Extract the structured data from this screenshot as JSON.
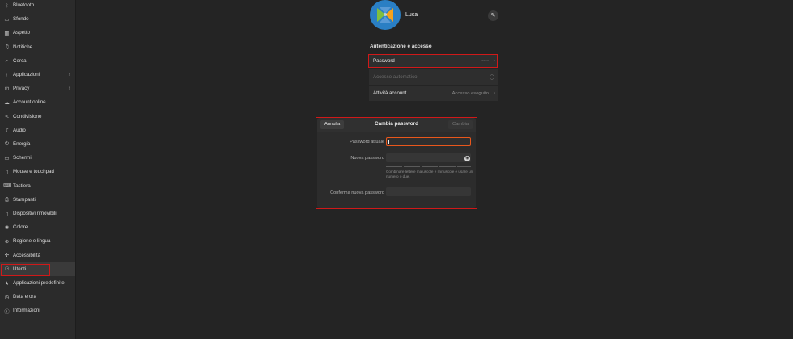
{
  "sidebar": {
    "items": [
      {
        "label": "Bluetooth",
        "icon": "bluetooth-icon",
        "glyph": "ᛒ"
      },
      {
        "label": "Sfondo",
        "icon": "wallpaper-icon",
        "glyph": "▭"
      },
      {
        "label": "Aspetto",
        "icon": "appearance-icon",
        "glyph": "▦"
      },
      {
        "label": "Notifiche",
        "icon": "bell-icon",
        "glyph": "♫"
      },
      {
        "label": "Cerca",
        "icon": "search-icon",
        "glyph": "⌕"
      },
      {
        "label": "Applicazioni",
        "icon": "apps-icon",
        "glyph": "⋮",
        "arrow": "›"
      },
      {
        "label": "Privacy",
        "icon": "lock-icon",
        "glyph": "⊡",
        "arrow": "›"
      },
      {
        "label": "Account online",
        "icon": "cloud-icon",
        "glyph": "☁"
      },
      {
        "label": "Condivisione",
        "icon": "share-icon",
        "glyph": "<"
      },
      {
        "label": "Audio",
        "icon": "music-note-icon",
        "glyph": "♪"
      },
      {
        "label": "Energia",
        "icon": "power-icon",
        "glyph": "⏻"
      },
      {
        "label": "Schermi",
        "icon": "display-icon",
        "glyph": "▭"
      },
      {
        "label": "Mouse e touchpad",
        "icon": "mouse-icon",
        "glyph": "▯"
      },
      {
        "label": "Tastiera",
        "icon": "keyboard-icon",
        "glyph": "⌨"
      },
      {
        "label": "Stampanti",
        "icon": "printer-icon",
        "glyph": "⎙"
      },
      {
        "label": "Dispositivi rimovibili",
        "icon": "usb-icon",
        "glyph": "▯"
      },
      {
        "label": "Colore",
        "icon": "palette-icon",
        "glyph": "✺"
      },
      {
        "label": "Regione e lingua",
        "icon": "globe-icon",
        "glyph": "⊕"
      },
      {
        "label": "Accessibilità",
        "icon": "accessibility-icon",
        "glyph": "✢"
      },
      {
        "label": "Utenti",
        "icon": "users-icon",
        "glyph": "⚇",
        "active": true
      },
      {
        "label": "Applicazioni predefinite",
        "icon": "star-icon",
        "glyph": "★"
      },
      {
        "label": "Data e ora",
        "icon": "clock-icon",
        "glyph": "◷"
      },
      {
        "label": "Informazioni",
        "icon": "info-icon",
        "glyph": "ⓘ"
      }
    ]
  },
  "user": {
    "name": "Luca",
    "edit_icon": "pencil-icon",
    "edit_glyph": "✎"
  },
  "auth": {
    "title": "Autenticazione e accesso",
    "password_label": "Password",
    "password_value": "•••••",
    "autologin_label": "Accesso automatico",
    "activity_label": "Attività account",
    "activity_value": "Accesso eseguito",
    "chevron": "›"
  },
  "dialog": {
    "title": "Cambia password",
    "cancel": "Annulla",
    "apply": "Cambia",
    "current_label": "Password attuale",
    "new_label": "Nuova password",
    "confirm_label": "Conferma nuova password",
    "hint": "Combinare lettere maiuscole e minuscole e usare un numero o due.",
    "peek_icon": "eye-icon",
    "peek_glyph": "◉"
  },
  "colors": {
    "accent": "#e9571c",
    "highlight": "#d01919",
    "avatar_blue": "#2a7fc4",
    "avatar_green": "#7fbf3f",
    "avatar_orange": "#f4a21c"
  }
}
